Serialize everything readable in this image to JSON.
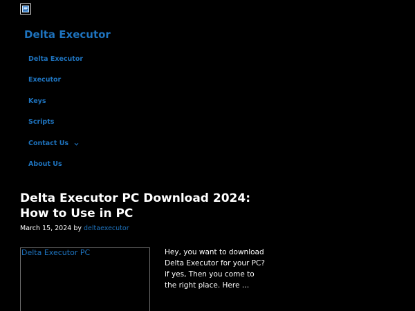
{
  "header": {
    "logo_icon": "broken-image-icon",
    "site_title": "Delta Executor"
  },
  "nav": {
    "items": [
      {
        "label": "Delta Executor"
      },
      {
        "label": "Executor"
      },
      {
        "label": "Keys"
      },
      {
        "label": "Scripts"
      },
      {
        "label": "Contact Us",
        "icon": "chevron-down-icon"
      },
      {
        "label": "About Us"
      }
    ]
  },
  "post": {
    "title": "Delta Executor PC Download 2024: How to Use in PC",
    "date": "March 15, 2024",
    "by": "by",
    "author": "deltaexecutor",
    "thumbnail_alt": "Delta Executor PC",
    "thumbnail_icon": "broken-image-icon",
    "excerpt": "Hey, you want to download Delta Executor for your PC? if yes, Then you come to the right place. Here …"
  },
  "colors": {
    "background": "#000000",
    "link": "#1e73be",
    "text": "#ffffff"
  }
}
